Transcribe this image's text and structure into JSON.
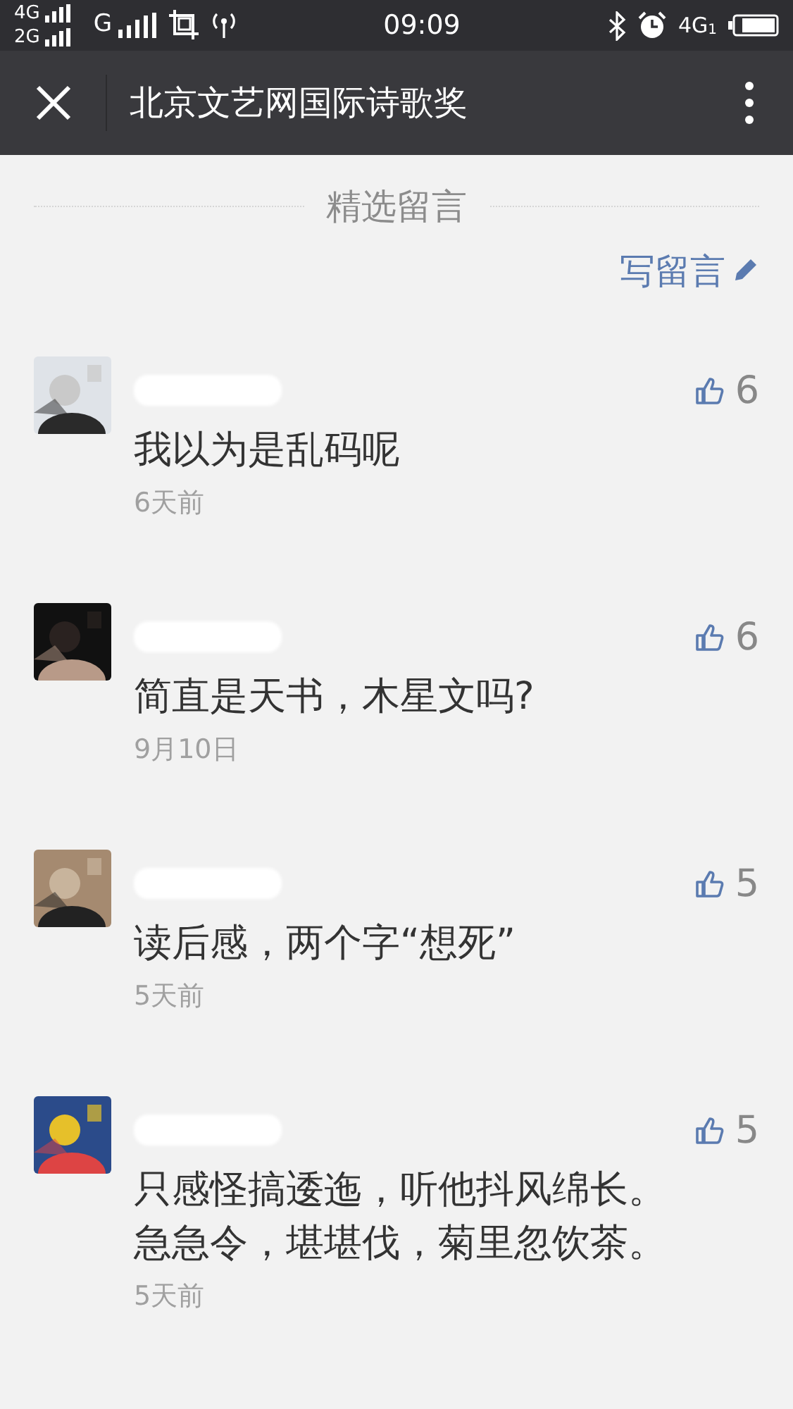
{
  "status_bar": {
    "sim1": "4G",
    "sim2": "2G",
    "network": "G",
    "time": "09:09",
    "data": "4G",
    "data_slot": "1"
  },
  "header": {
    "title": "北京文艺网国际诗歌奖"
  },
  "section": {
    "title": "精选留言",
    "write_link": "写留言"
  },
  "comments": [
    {
      "kind": "picture",
      "lines": [
        "我以为是乱码呢"
      ],
      "time": "6天前",
      "likes": "6"
    },
    {
      "kind": "picture",
      "lines": [
        "简直是天书，木星文吗?"
      ],
      "time": "9月10日",
      "likes": "6"
    },
    {
      "kind": "picture",
      "lines": [
        "读后感，两个字“想死”"
      ],
      "time": "5天前",
      "likes": "5"
    },
    {
      "kind": "picture",
      "lines": [
        "只感怪搞逶迤，听他抖风绵长。",
        "急急令，堪堪伐，菊里忽饮茶。"
      ],
      "time": "5天前",
      "likes": "5"
    }
  ]
}
